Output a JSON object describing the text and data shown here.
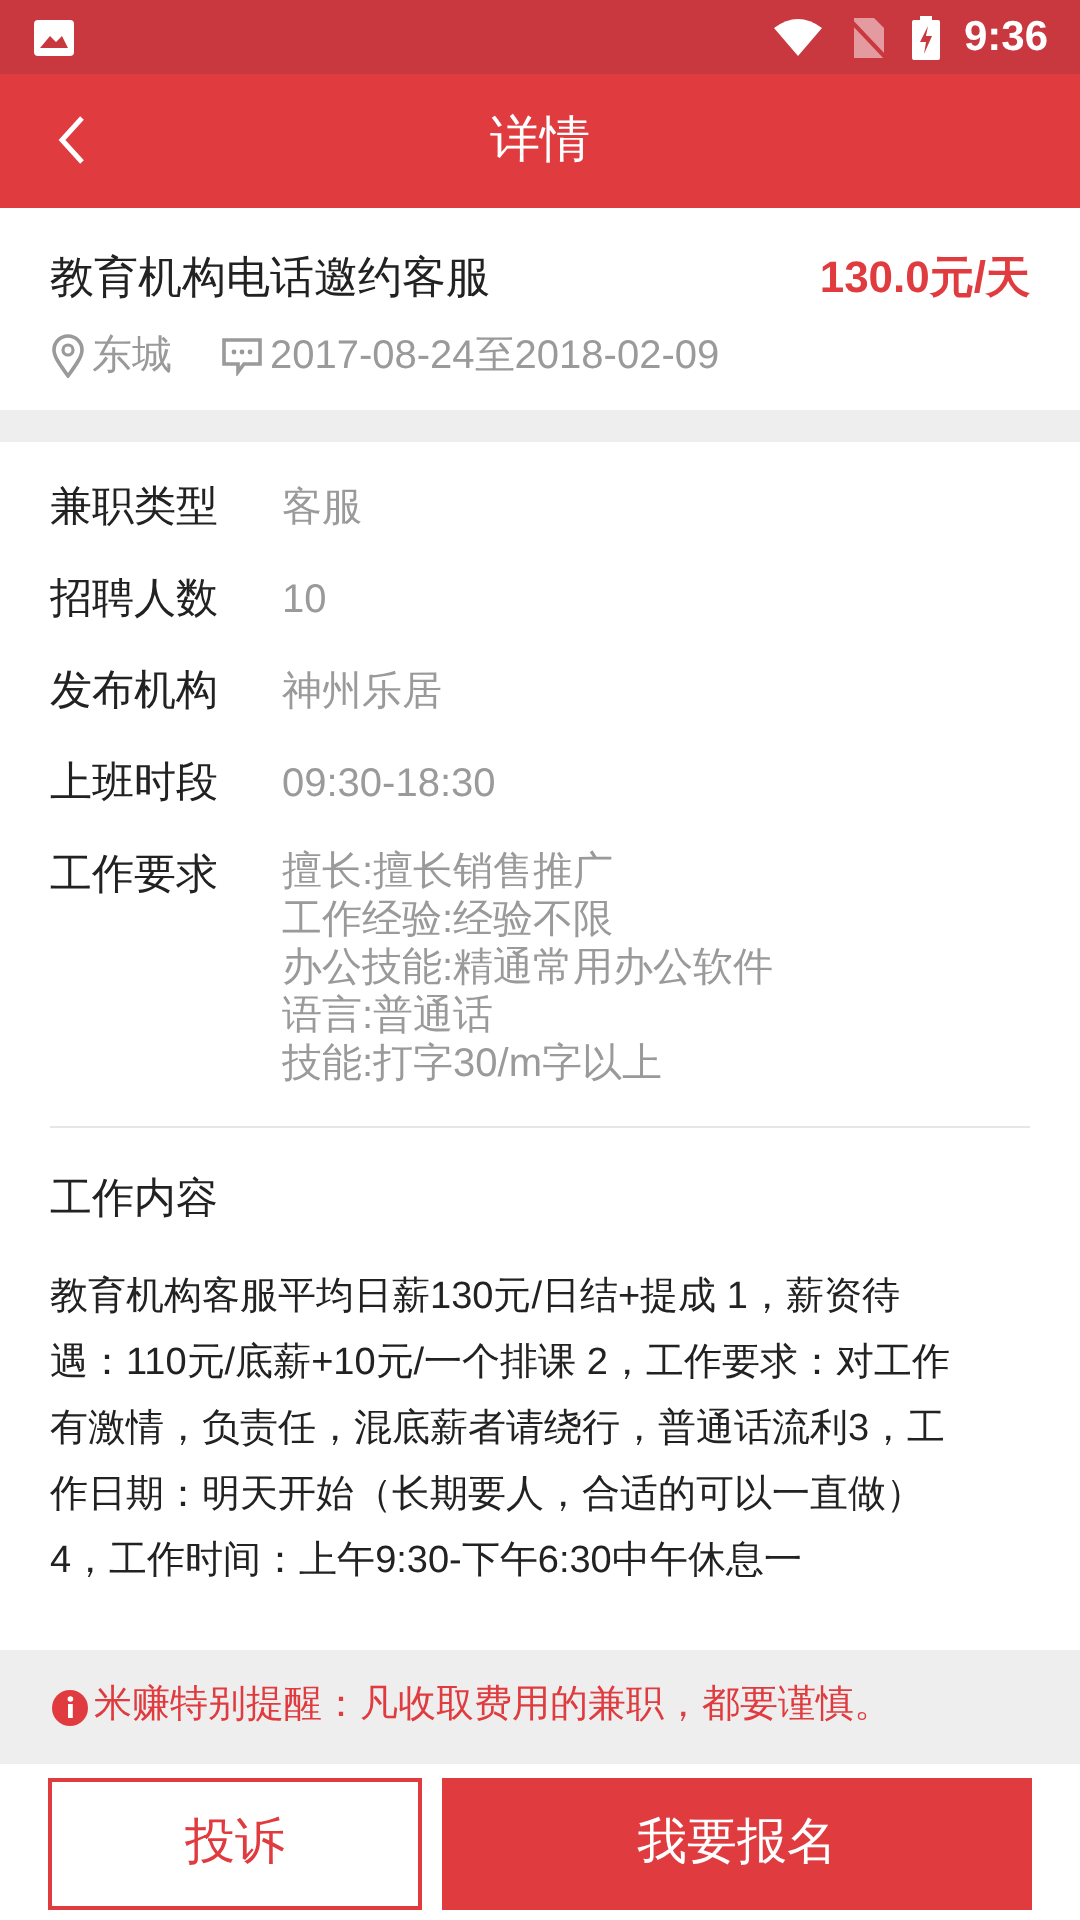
{
  "status_bar": {
    "time": "9:36"
  },
  "header": {
    "title": "详情"
  },
  "job": {
    "title": "教育机构电话邀约客服",
    "salary": "130.0元/天",
    "district": "东城",
    "period": "2017-08-24至2018-02-09"
  },
  "details": [
    {
      "label": "兼职类型",
      "lines": [
        "客服"
      ]
    },
    {
      "label": "招聘人数",
      "lines": [
        "10"
      ]
    },
    {
      "label": "发布机构",
      "lines": [
        "神州乐居"
      ]
    },
    {
      "label": "上班时段",
      "lines": [
        "09:30-18:30"
      ]
    },
    {
      "label": "工作要求",
      "lines": [
        "擅长:擅长销售推广",
        "工作经验:经验不限",
        "办公技能:精通常用办公软件",
        "语言:普通话",
        "技能:打字30/m字以上"
      ]
    }
  ],
  "content": {
    "heading": "工作内容",
    "text": "教育机构客服平均日薪130元/日结+提成 1，薪资待遇：110元/底薪+10元/一个排课 2，工作要求：对工作有激情，负责任，混底薪者请绕行，普通话流利3，工作日期：明天开始（长期要人，合适的可以一直做） 4，工作时间：上午9:30-下午6:30中午休息一"
  },
  "notice": "米赚特别提醒：凡收取费用的兼职，都要谨慎。",
  "buttons": [
    {
      "label": "投诉",
      "kind": "outline"
    },
    {
      "label": "我要报名",
      "kind": "filled"
    }
  ]
}
